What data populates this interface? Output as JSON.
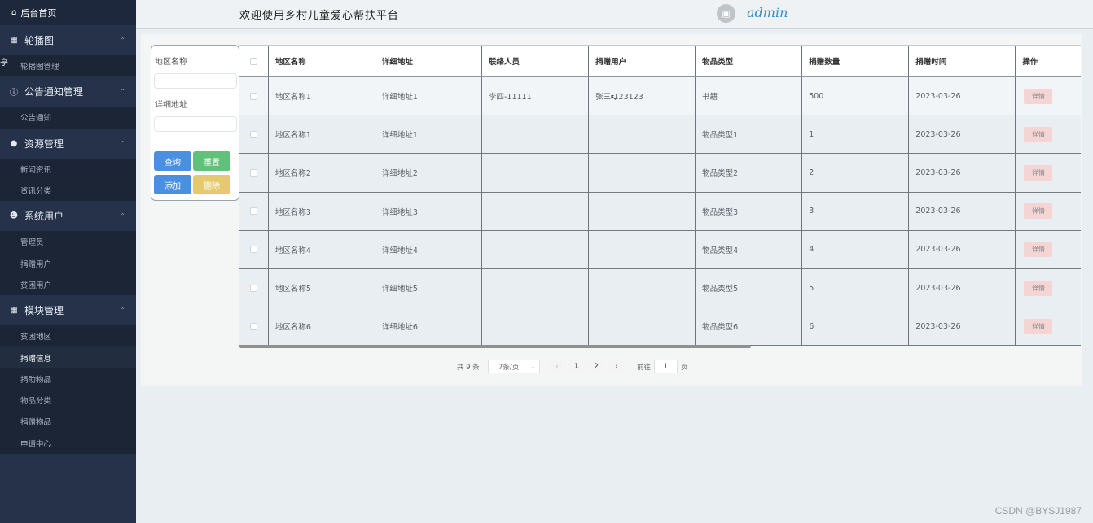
{
  "sidebar": {
    "home": "后台首页",
    "stop_tag": "亭",
    "groups": [
      {
        "label": "轮播图",
        "icon": "image-icon",
        "items": [
          "轮播图管理"
        ]
      },
      {
        "label": "公告通知管理",
        "icon": "info-icon",
        "items": [
          "公告通知"
        ]
      },
      {
        "label": "资源管理",
        "icon": "location-icon",
        "items": [
          "新闻资讯",
          "资讯分类"
        ]
      },
      {
        "label": "系统用户",
        "icon": "user-icon",
        "items": [
          "管理员",
          "捐赠用户",
          "贫困用户"
        ]
      },
      {
        "label": "模块管理",
        "icon": "grid-icon",
        "items": [
          "贫困地区",
          "捐赠信息",
          "捐助物品",
          "物品分类",
          "捐赠物品",
          "申请中心"
        ]
      }
    ],
    "active_item": "捐赠信息"
  },
  "header": {
    "title": "欢迎使用乡村儿童爱心帮扶平台",
    "username": "admin"
  },
  "search": {
    "region_label": "地区名称",
    "address_label": "详细地址",
    "region_value": "",
    "address_value": "",
    "query": "查询",
    "reset": "重置",
    "add": "添加",
    "delete": "删除"
  },
  "table": {
    "headers": [
      "地区名称",
      "详细地址",
      "联络人员",
      "捐赠用户",
      "物品类型",
      "捐赠数量",
      "捐赠时间",
      "操作"
    ],
    "detail_label": "详情",
    "rows": [
      [
        "地区名称1",
        "详细地址1",
        "李四-11111",
        "张三-123123",
        "书籍",
        "500",
        "2023-03-26"
      ],
      [
        "地区名称1",
        "详细地址1",
        "",
        "",
        "物品类型1",
        "1",
        "2023-03-26"
      ],
      [
        "地区名称2",
        "详细地址2",
        "",
        "",
        "物品类型2",
        "2",
        "2023-03-26"
      ],
      [
        "地区名称3",
        "详细地址3",
        "",
        "",
        "物品类型3",
        "3",
        "2023-03-26"
      ],
      [
        "地区名称4",
        "详细地址4",
        "",
        "",
        "物品类型4",
        "4",
        "2023-03-26"
      ],
      [
        "地区名称5",
        "详细地址5",
        "",
        "",
        "物品类型5",
        "5",
        "2023-03-26"
      ],
      [
        "地区名称6",
        "详细地址6",
        "",
        "",
        "物品类型6",
        "6",
        "2023-03-26"
      ]
    ]
  },
  "pagination": {
    "total": "共 9 条",
    "page_size": "7条/页",
    "pages": [
      "1",
      "2"
    ],
    "current": "1",
    "goto": "前往",
    "jump_value": "1",
    "page_unit": "页"
  },
  "watermark": "CSDN @BYSJ1987"
}
